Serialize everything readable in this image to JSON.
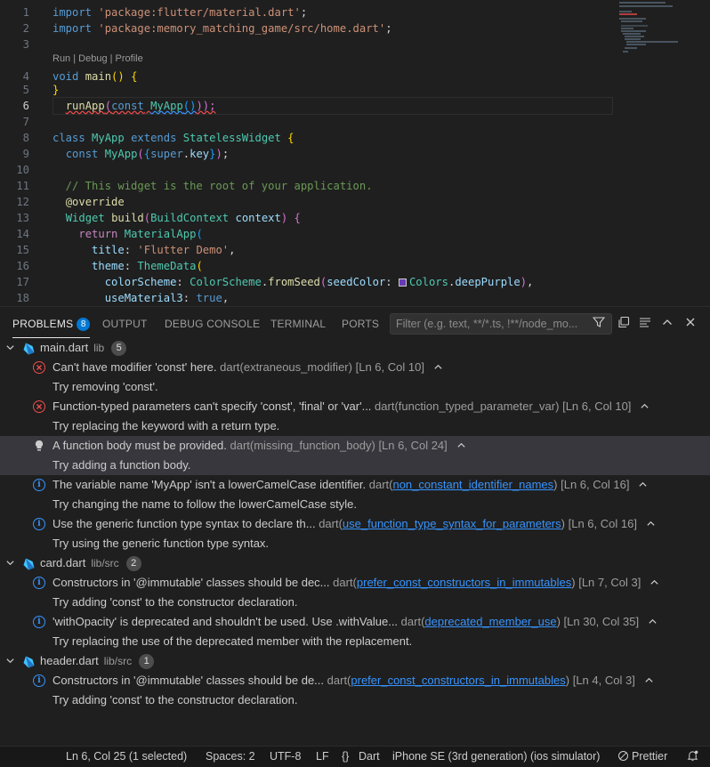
{
  "editor": {
    "codelens": "Run | Debug | Profile",
    "lines": [
      {
        "n": "1",
        "tokens": [
          [
            "k",
            "import "
          ],
          [
            "s",
            "'package:flutter/material.dart'"
          ],
          [
            "p",
            ";"
          ]
        ]
      },
      {
        "n": "2",
        "tokens": [
          [
            "k",
            "import "
          ],
          [
            "s",
            "'package:memory_matching_game/src/home.dart'"
          ],
          [
            "p",
            ";"
          ]
        ]
      },
      {
        "n": "3",
        "tokens": []
      },
      {
        "n": "4",
        "tokens": [
          [
            "k",
            "void "
          ],
          [
            "f",
            "main"
          ],
          [
            "b",
            "()"
          ],
          [
            "p",
            " "
          ],
          [
            "b",
            "{"
          ]
        ]
      },
      {
        "n": "5",
        "tokens": [
          [
            "b",
            "}"
          ]
        ]
      },
      {
        "n": "6",
        "tokens": [
          [
            "p",
            "  "
          ],
          [
            "f squig",
            "runApp"
          ],
          [
            "b2 squig",
            "("
          ],
          [
            "k squig",
            "const"
          ],
          [
            "p squig",
            " "
          ],
          [
            "t squig-b",
            "MyApp"
          ],
          [
            "b3 squig-b",
            "()"
          ],
          [
            "b2 squig",
            "));"
          ]
        ]
      },
      {
        "n": "7",
        "tokens": []
      },
      {
        "n": "8",
        "tokens": [
          [
            "k",
            "class "
          ],
          [
            "t",
            "MyApp "
          ],
          [
            "k",
            "extends "
          ],
          [
            "t",
            "StatelessWidget "
          ],
          [
            "b",
            "{"
          ]
        ]
      },
      {
        "n": "9",
        "tokens": [
          [
            "p",
            "  "
          ],
          [
            "k",
            "const "
          ],
          [
            "t",
            "MyApp"
          ],
          [
            "b2",
            "("
          ],
          [
            "b3",
            "{"
          ],
          [
            "k",
            "super"
          ],
          [
            "p",
            "."
          ],
          [
            "v",
            "key"
          ],
          [
            "b3",
            "}"
          ],
          [
            "b2",
            ")"
          ],
          [
            "p",
            ";"
          ]
        ]
      },
      {
        "n": "10",
        "tokens": []
      },
      {
        "n": "11",
        "tokens": [
          [
            "c",
            "  // This widget is the root of your application."
          ]
        ]
      },
      {
        "n": "12",
        "tokens": [
          [
            "p",
            "  "
          ],
          [
            "f",
            "@override"
          ]
        ]
      },
      {
        "n": "13",
        "tokens": [
          [
            "p",
            "  "
          ],
          [
            "t",
            "Widget "
          ],
          [
            "f",
            "build"
          ],
          [
            "b2",
            "("
          ],
          [
            "t",
            "BuildContext "
          ],
          [
            "v",
            "context"
          ],
          [
            "b2",
            ")"
          ],
          [
            "p",
            " "
          ],
          [
            "b2",
            "{"
          ]
        ]
      },
      {
        "n": "14",
        "tokens": [
          [
            "p",
            "    "
          ],
          [
            "kc",
            "return "
          ],
          [
            "t",
            "MaterialApp"
          ],
          [
            "b3",
            "("
          ]
        ]
      },
      {
        "n": "15",
        "tokens": [
          [
            "p",
            "      "
          ],
          [
            "v",
            "title"
          ],
          [
            "p",
            ": "
          ],
          [
            "s",
            "'Flutter Demo'"
          ],
          [
            "p",
            ","
          ]
        ]
      },
      {
        "n": "16",
        "tokens": [
          [
            "p",
            "      "
          ],
          [
            "v",
            "theme"
          ],
          [
            "p",
            ": "
          ],
          [
            "t",
            "ThemeData"
          ],
          [
            "b",
            "("
          ]
        ]
      },
      {
        "n": "17",
        "tokens": [
          [
            "p",
            "        "
          ],
          [
            "v",
            "colorScheme"
          ],
          [
            "p",
            ": "
          ],
          [
            "t",
            "ColorScheme"
          ],
          [
            "p",
            "."
          ],
          [
            "f",
            "fromSeed"
          ],
          [
            "b2",
            "("
          ],
          [
            "v",
            "seedColor"
          ],
          [
            "p",
            ": "
          ],
          [
            "swatch",
            ""
          ],
          [
            "t",
            "Colors"
          ],
          [
            "p",
            "."
          ],
          [
            "v",
            "deepPurple"
          ],
          [
            "b2",
            ")"
          ],
          [
            "p",
            ","
          ]
        ]
      },
      {
        "n": "18",
        "tokens": [
          [
            "p",
            "        "
          ],
          [
            "v",
            "useMaterial3"
          ],
          [
            "p",
            ": "
          ],
          [
            "k",
            "true"
          ],
          [
            "p",
            ","
          ]
        ]
      }
    ]
  },
  "panel": {
    "tabs": [
      {
        "label": "PROBLEMS",
        "badge": "8"
      },
      {
        "label": "OUTPUT"
      },
      {
        "label": "DEBUG CONSOLE"
      },
      {
        "label": "TERMINAL"
      },
      {
        "label": "PORTS"
      }
    ],
    "filter_placeholder": "Filter (e.g. text, **/*.ts, !**/node_mo..."
  },
  "problems": {
    "groups": [
      {
        "file": "main.dart",
        "path": "lib",
        "count": "5",
        "items": [
          {
            "sev": "err",
            "msg": "Can't have modifier 'const' here.",
            "src": "dart(",
            "code": "extraneous_modifier",
            "link": false,
            "loc": "[Ln 6, Col 10]",
            "sub": "Try removing 'const'."
          },
          {
            "sev": "err",
            "msg": "Function-typed parameters can't specify 'const', 'final' or 'var'...",
            "src": "dart(",
            "code": "function_typed_parameter_var",
            "link": false,
            "loc": "[Ln 6, Col 10]",
            "sub": "Try replacing the keyword with a return type."
          },
          {
            "sev": "hint",
            "msg": "A function body must be provided.",
            "src": "dart(",
            "code": "missing_function_body",
            "link": false,
            "loc": "[Ln 6, Col 24]",
            "sub": "Try adding a function body.",
            "selected": true
          },
          {
            "sev": "info",
            "msg": "The variable name 'MyApp' isn't a lowerCamelCase identifier.",
            "src": "dart(",
            "code": "non_constant_identifier_names",
            "link": true,
            "loc": "[Ln 6, Col 16]",
            "sub": "Try changing the name to follow the lowerCamelCase style."
          },
          {
            "sev": "info",
            "msg": "Use the generic function type syntax to declare th...",
            "src": "dart(",
            "code": "use_function_type_syntax_for_parameters",
            "link": true,
            "loc": "[Ln 6, Col 16]",
            "sub": "Try using the generic function type syntax."
          }
        ]
      },
      {
        "file": "card.dart",
        "path": "lib/src",
        "count": "2",
        "items": [
          {
            "sev": "info",
            "msg": "Constructors in '@immutable' classes should be dec...",
            "src": "dart(",
            "code": "prefer_const_constructors_in_immutables",
            "link": true,
            "loc": "[Ln 7, Col 3]",
            "sub": "Try adding 'const' to the constructor declaration."
          },
          {
            "sev": "info",
            "msg": "'withOpacity' is deprecated and shouldn't be used. Use .withValue...",
            "src": "dart(",
            "code": "deprecated_member_use",
            "link": true,
            "loc": "[Ln 30, Col 35]",
            "sub": "Try replacing the use of the deprecated member with the replacement."
          }
        ]
      },
      {
        "file": "header.dart",
        "path": "lib/src",
        "count": "1",
        "items": [
          {
            "sev": "info",
            "msg": "Constructors in '@immutable' classes should be de...",
            "src": "dart(",
            "code": "prefer_const_constructors_in_immutables",
            "link": true,
            "loc": "[Ln 4, Col 3]",
            "sub": "Try adding 'const' to the constructor declaration."
          }
        ]
      }
    ]
  },
  "statusbar": {
    "cursor": "Ln 6, Col 25 (1 selected)",
    "spaces": "Spaces: 2",
    "encoding": "UTF-8",
    "eol": "LF",
    "language": "Dart",
    "device": "iPhone SE (3rd generation) (ios simulator)",
    "prettier": "Prettier"
  },
  "icons": {
    "filter": "filter-icon",
    "copy": "copy-icon",
    "list": "list-view-icon",
    "up": "chevron-up-icon",
    "close": "close-icon",
    "bell": "bell-icon"
  }
}
